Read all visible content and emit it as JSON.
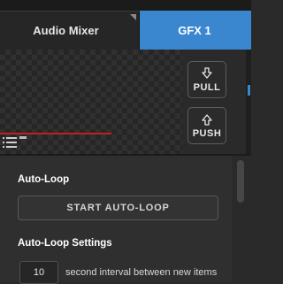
{
  "tabs": [
    {
      "label": "Audio Mixer",
      "active": false
    },
    {
      "label": "GFX 1",
      "active": true
    }
  ],
  "colors": {
    "accent": "#3a87d0",
    "live_line": "#c0201f"
  },
  "side_buttons": {
    "pull": {
      "label": "PULL",
      "icon": "arrow-down-outline-icon"
    },
    "push": {
      "label": "PUSH",
      "icon": "arrow-up-outline-icon"
    }
  },
  "autoloop": {
    "heading": "Auto-Loop",
    "start_label": "START AUTO-LOOP"
  },
  "settings": {
    "heading": "Auto-Loop Settings",
    "interval_value": "10",
    "interval_label": "second interval between new items"
  }
}
